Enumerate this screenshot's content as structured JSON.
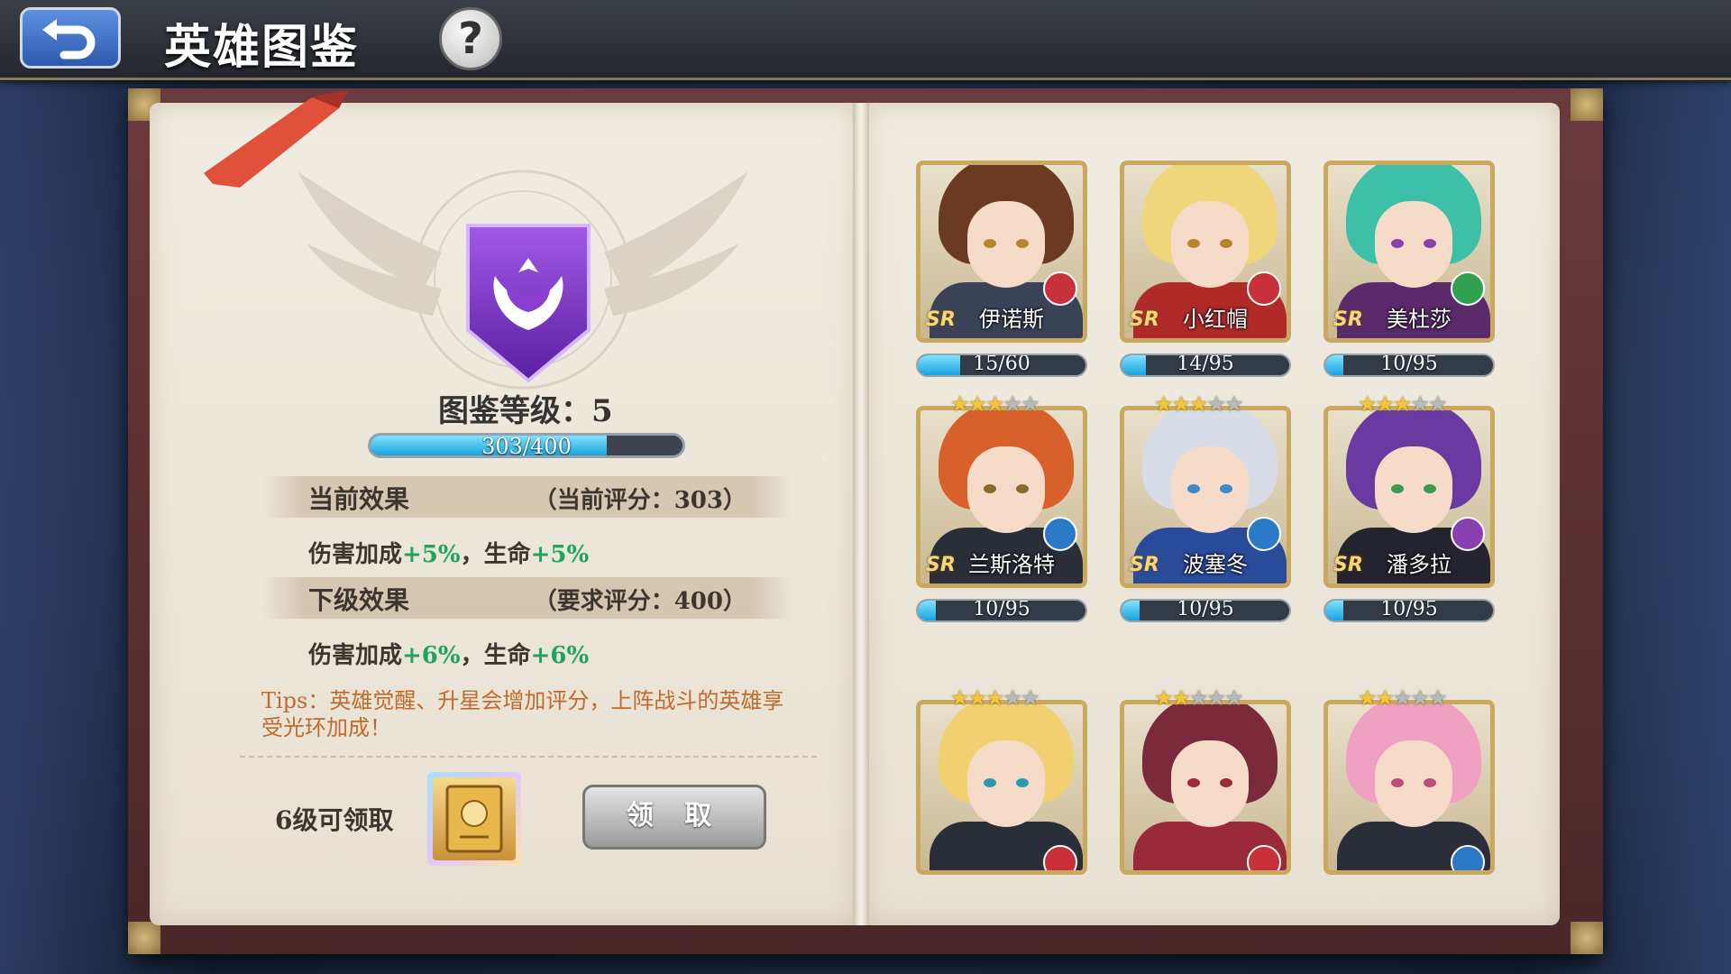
{
  "header": {
    "title": "英雄图鉴",
    "help_glyph": "?"
  },
  "collection": {
    "level_label": "图鉴等级：5",
    "exp_current": 303,
    "exp_max": 400,
    "exp_text": "303/400"
  },
  "current_effect": {
    "title": "当前效果",
    "score_text": "（当前评分：303）",
    "effect_prefix": "伤害加成",
    "dmg": "+5%",
    "sep": "，生命",
    "hp": "+5%"
  },
  "next_effect": {
    "title": "下级效果",
    "score_text": "（要求评分：400）",
    "effect_prefix": "伤害加成",
    "dmg": "+6%",
    "sep": "，生命",
    "hp": "+6%"
  },
  "tips": "Tips：英雄觉醒、升星会增加评分，上阵战斗的英雄享受光环加成！",
  "reward": {
    "label": "6级可领取",
    "claim_label": "领 取"
  },
  "colors": {
    "accent": "#1aa3e0",
    "bonus": "#1fa55a",
    "tips": "#c06a2c",
    "emblem": "#8a3fd0"
  },
  "heroes": [
    {
      "name": "伊诺斯",
      "rarity": "SR",
      "stars": null,
      "progress": "15/60",
      "ratio": 0.25,
      "class_color": "#c8303a",
      "hair": "#6b3a22",
      "outfit": "#3a4258",
      "eye": "#b8862a"
    },
    {
      "name": "小红帽",
      "rarity": "SR",
      "stars": null,
      "progress": "14/95",
      "ratio": 0.147,
      "class_color": "#c8303a",
      "hair": "#f0d67a",
      "outfit": "#b02a2a",
      "eye": "#b8862a"
    },
    {
      "name": "美杜莎",
      "rarity": "SR",
      "stars": null,
      "progress": "10/95",
      "ratio": 0.105,
      "class_color": "#2fa050",
      "hair": "#3ec0a8",
      "outfit": "#5a2a6a",
      "eye": "#8a40b0"
    },
    {
      "name": "兰斯洛特",
      "rarity": "SR",
      "stars": 3,
      "progress": "10/95",
      "ratio": 0.105,
      "class_color": "#2a7ac8",
      "hair": "#d8602a",
      "outfit": "#2a2e38",
      "eye": "#8a6a2a"
    },
    {
      "name": "波塞冬",
      "rarity": "SR",
      "stars": 3,
      "progress": "10/95",
      "ratio": 0.105,
      "class_color": "#2a7ac8",
      "hair": "#d8dce6",
      "outfit": "#2a4a9a",
      "eye": "#3a8ad0"
    },
    {
      "name": "潘多拉",
      "rarity": "SR",
      "stars": 3,
      "progress": "10/95",
      "ratio": 0.105,
      "class_color": "#8a3fb0",
      "hair": "#6a3aa0",
      "outfit": "#24242e",
      "eye": "#3a9a50"
    },
    {
      "name": "",
      "rarity": "",
      "stars": 3,
      "progress": "",
      "ratio": 0,
      "class_color": "#c8303a",
      "hair": "#f0d070",
      "outfit": "#2a2e38",
      "eye": "#2a9ab0"
    },
    {
      "name": "",
      "rarity": "",
      "stars": 2,
      "progress": "",
      "ratio": 0,
      "class_color": "#c8303a",
      "hair": "#7a2a3a",
      "outfit": "#9a2a3a",
      "eye": "#a02a3a"
    },
    {
      "name": "",
      "rarity": "",
      "stars": 2,
      "progress": "",
      "ratio": 0,
      "class_color": "#2a7ac8",
      "hair": "#f0a0c0",
      "outfit": "#2a2e38",
      "eye": "#c04a7a"
    }
  ]
}
